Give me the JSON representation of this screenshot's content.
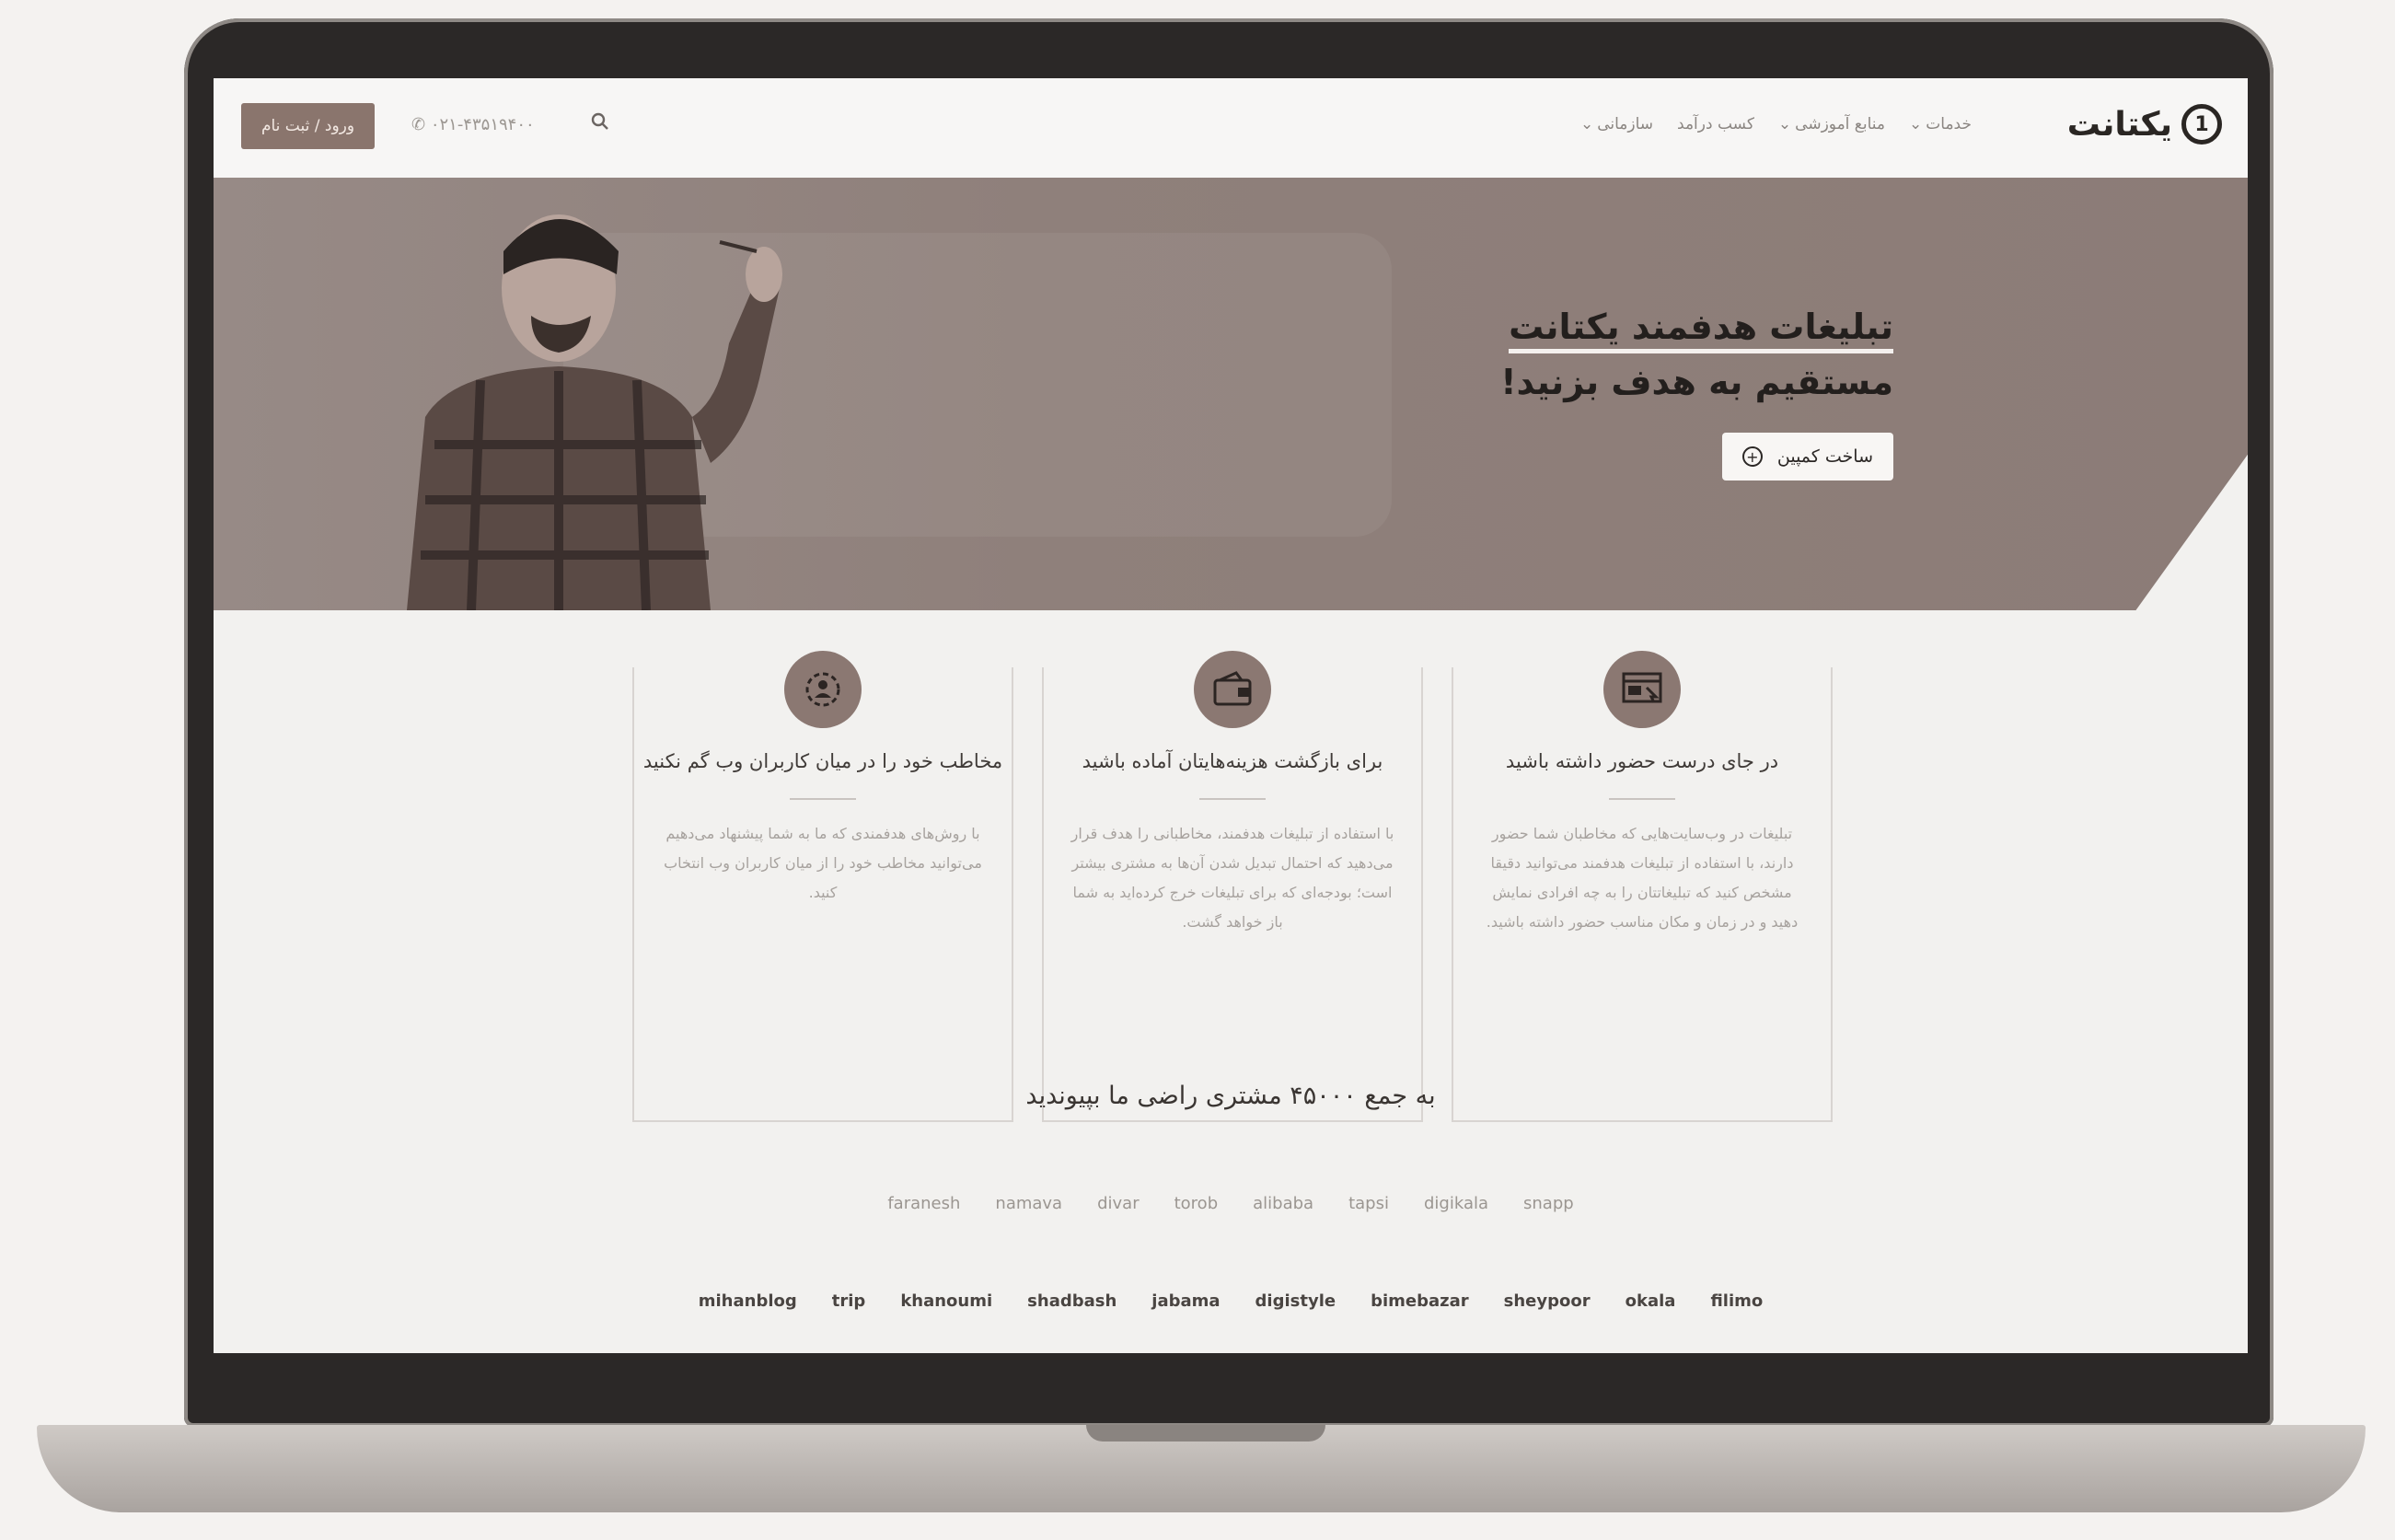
{
  "header": {
    "logo_text": "یکتانت",
    "logo_mark": "1",
    "nav": [
      {
        "label": "خدمات",
        "has_dropdown": true
      },
      {
        "label": "منابع آموزشی",
        "has_dropdown": true
      },
      {
        "label": "کسب درآمد",
        "has_dropdown": false
      },
      {
        "label": "سازمانی",
        "has_dropdown": true
      }
    ],
    "phone": "۰۲۱-۴۳۵۱۹۴۰۰",
    "login_label": "ورود / ثبت نام",
    "search_icon": "search-icon"
  },
  "hero": {
    "title_line1": "تبلیغات هدفمند یکتانت",
    "title_line2": "مستقیم به هدف بزنید!",
    "cta_label": "ساخت کمپین",
    "cta_icon": "plus-circle-icon"
  },
  "features": [
    {
      "icon": "website-target-icon",
      "title": "در جای درست حضور داشته باشید",
      "text": "تبلیغات در وب‌سایت‌هایی که مخاطبان شما حضور دارند، با استفاده از تبلیغات هدفمند می‌توانید دقیقا مشخص کنید که تبلیغاتتان را به چه افرادی نمایش دهید و در زمان و مکان مناسب حضور داشته باشید."
    },
    {
      "icon": "wallet-icon",
      "title": "برای بازگشت هزینه‌هایتان آماده باشید",
      "text": "با استفاده از تبلیغات هدفمند، مخاطبانی را هدف قرار می‌دهید که احتمال تبدیل شدن آن‌ها به مشتری بیشتر است؛ بودجه‌ای که برای تبلیغات خرج کرده‌اید به شما باز خواهد گشت."
    },
    {
      "icon": "audience-icon",
      "title": "مخاطب خود را در میان کاربران وب گم نکنید",
      "text": "با روش‌های هدفمندی که ما به شما پیشنهاد می‌دهیم می‌توانید مخاطب خود را از میان کاربران وب انتخاب کنید."
    }
  ],
  "customers": {
    "title": "به جمع ۴۵۰۰۰ مشتری راضی ما بپیوندید",
    "row1": [
      "snapp",
      "digikala",
      "tapsi",
      "alibaba",
      "torob",
      "divar",
      "namava",
      "faranesh"
    ],
    "row2": [
      "filimo",
      "okala",
      "sheypoor",
      "bimebazar",
      "digistyle",
      "jabama",
      "shadbash",
      "khanoumi",
      "trip",
      "mihanblog"
    ]
  },
  "colors": {
    "accent": "#8a756d",
    "hero_bg": "#8f807b",
    "text_dark": "#231f1d"
  }
}
